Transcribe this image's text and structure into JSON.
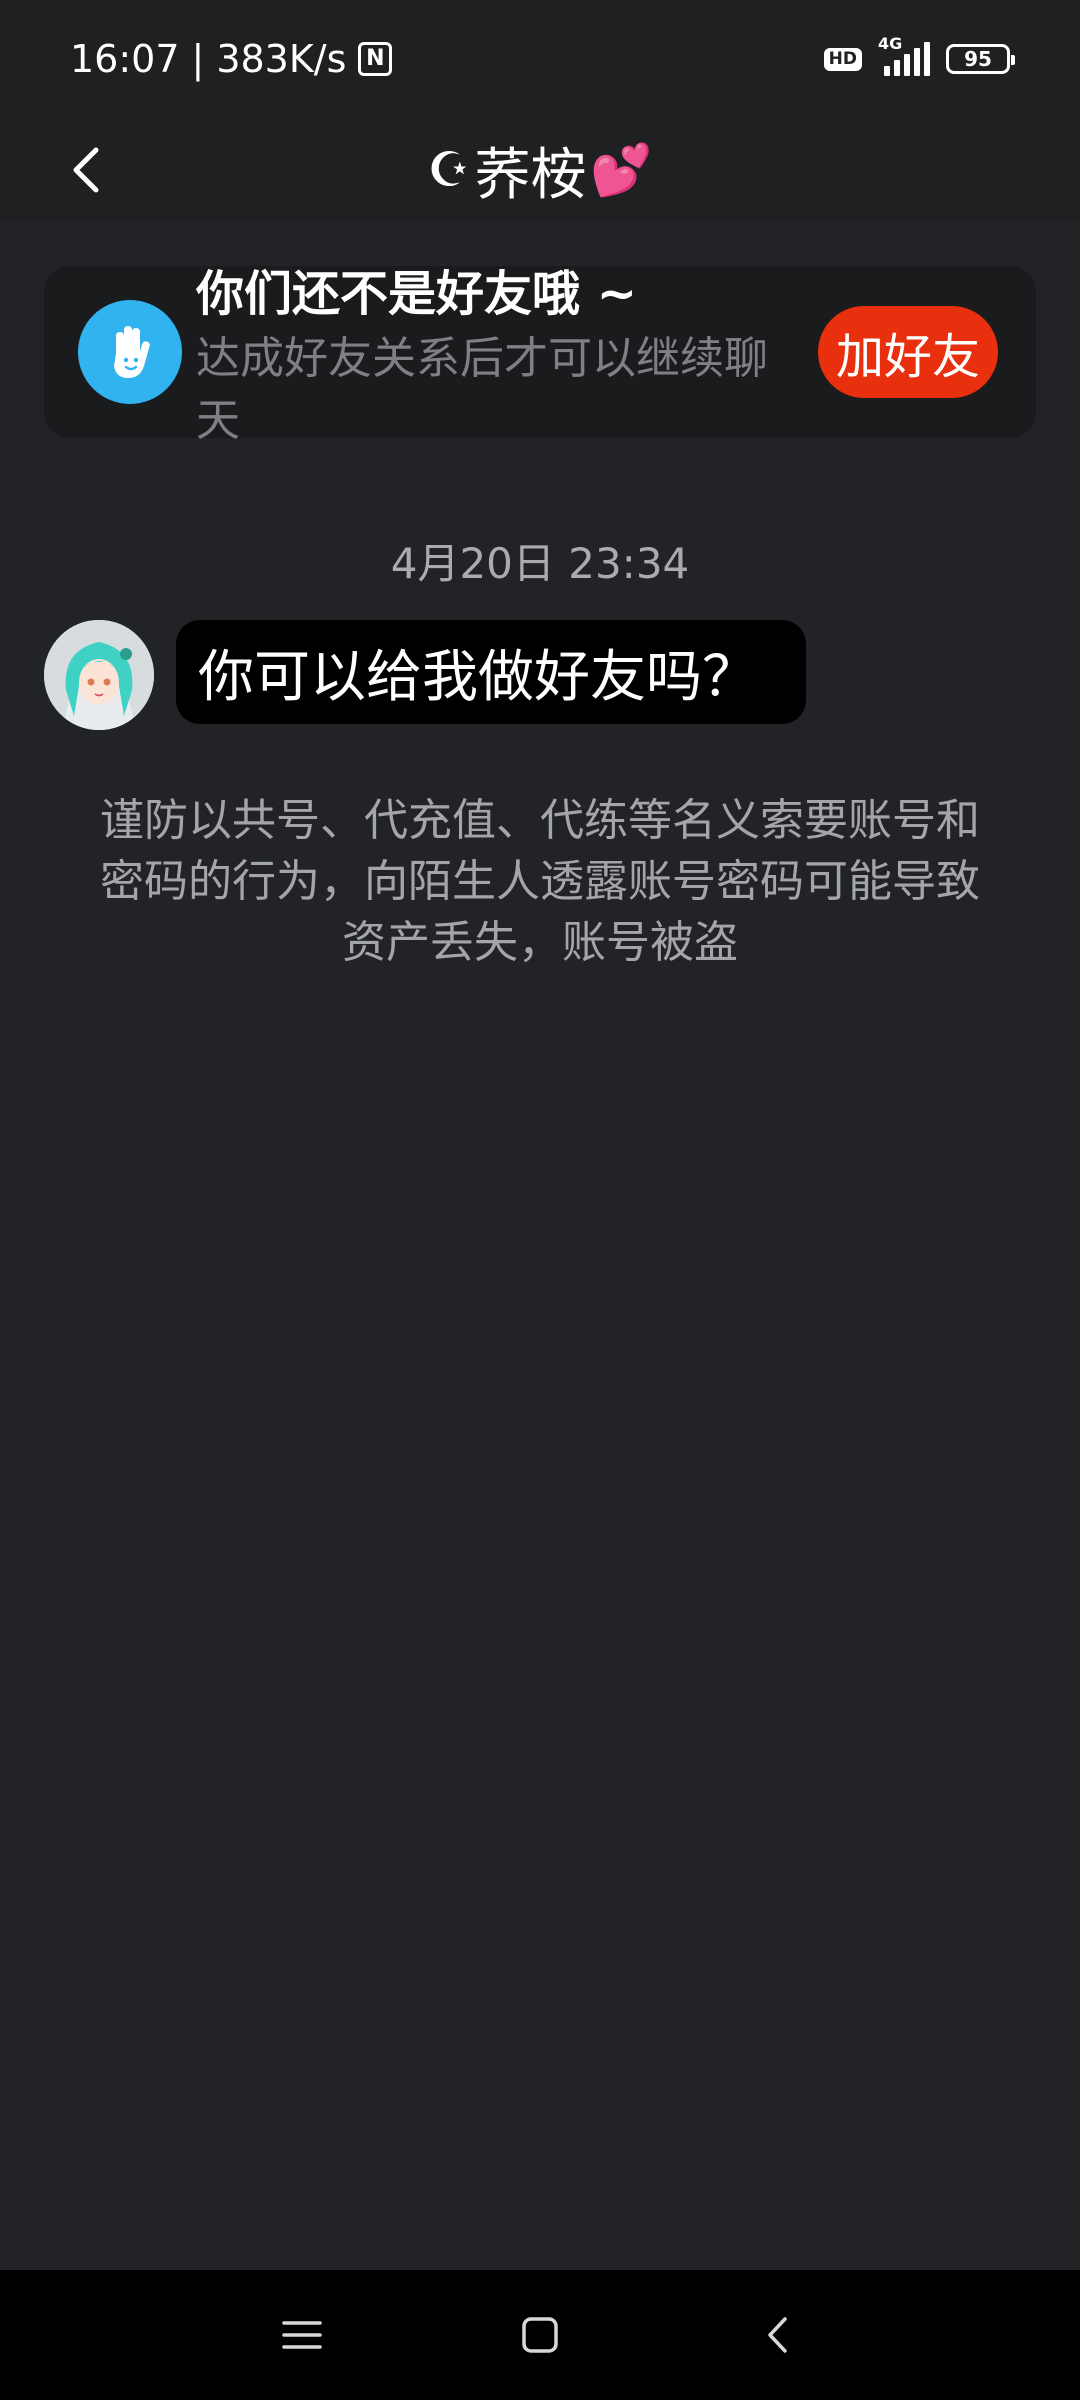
{
  "status_bar": {
    "time": "16:07",
    "separator": "|",
    "speed": "383K/s",
    "nfc_glyph": "N",
    "hd": "HD",
    "network": "4G",
    "battery": "95",
    "signal_level": 5
  },
  "header": {
    "title_prefix": "☪",
    "title": "荞桉",
    "title_suffix": "💕"
  },
  "friend_banner": {
    "title": "你们还不是好友哦 ~",
    "subtitle": "达成好友关系后才可以继续聊天",
    "button_label": "加好友",
    "icon": "wave-hand-icon",
    "accent_color": "#e8300e"
  },
  "chat": {
    "timestamp": "4月20日 23:34",
    "messages": [
      {
        "sender": "other",
        "text": "你可以给我做好友吗？"
      }
    ],
    "warning": "谨防以共号、代充值、代练等名义索要账号和密码的行为，向陌生人透露账号密码可能导致资产丢失，账号被盗"
  },
  "nav": {
    "icons": [
      "menu-icon",
      "home-icon",
      "back-icon"
    ]
  }
}
